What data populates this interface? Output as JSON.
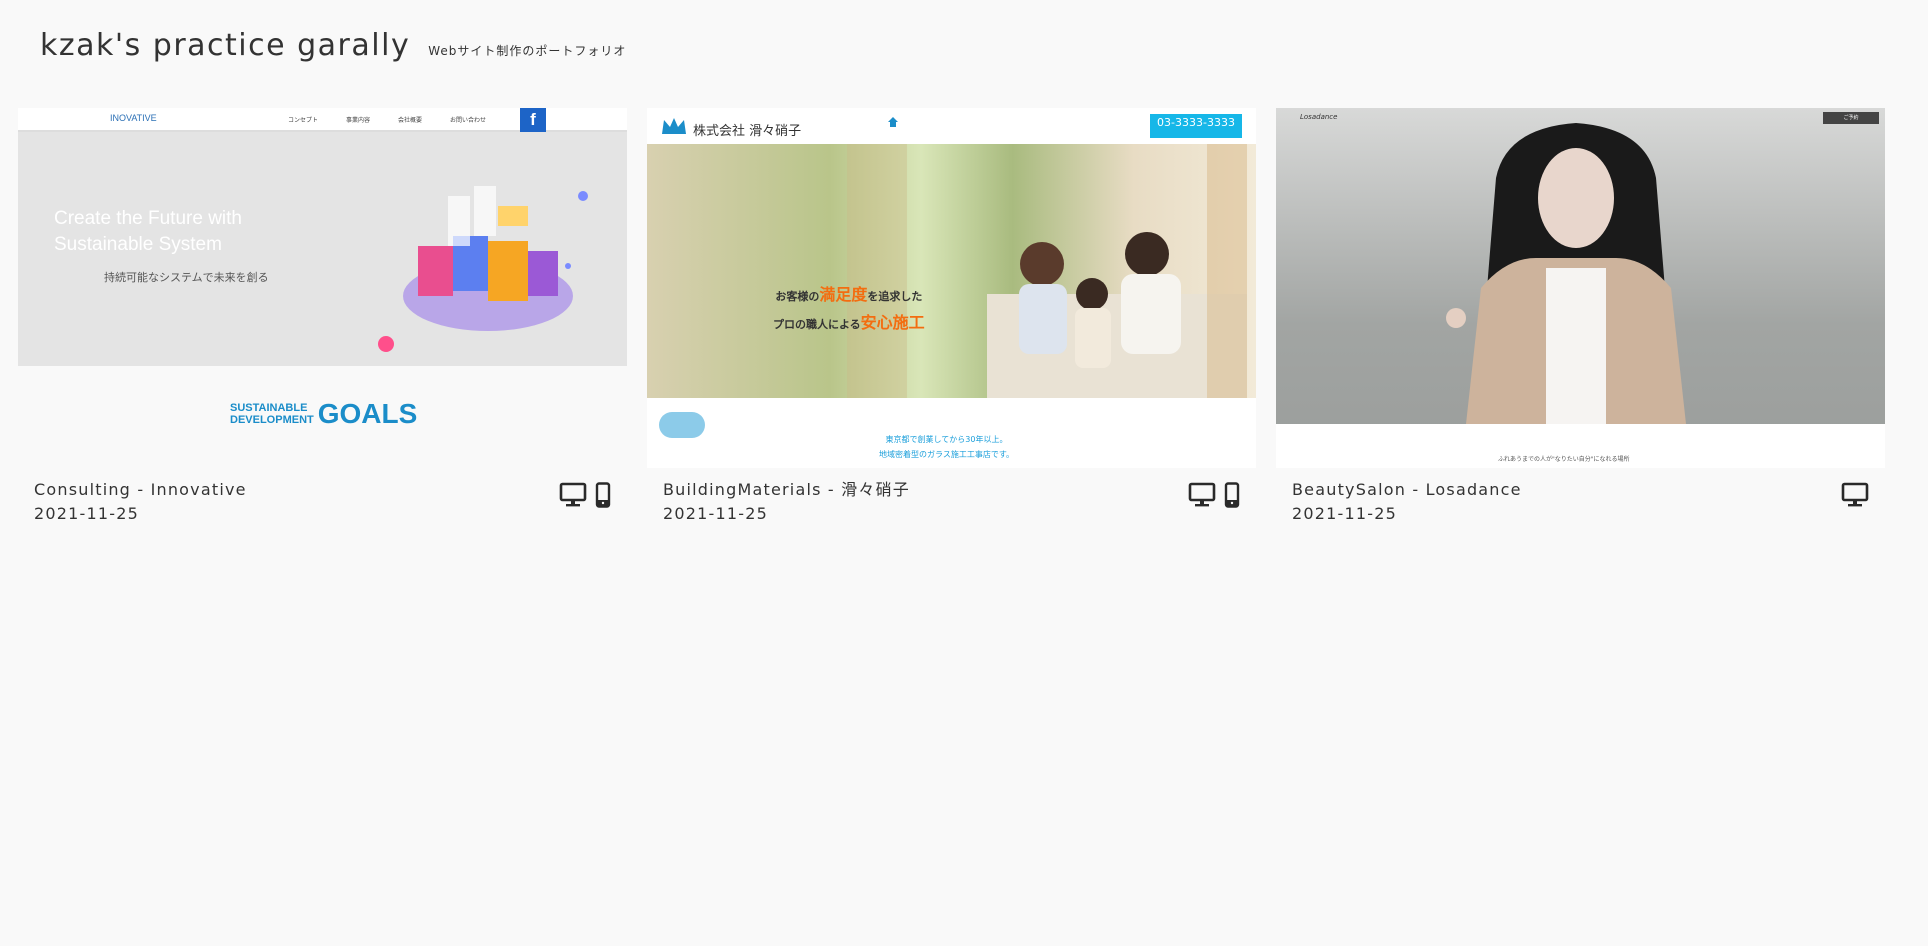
{
  "header": {
    "title": "kzak's practice garally",
    "subtitle": "Webサイト制作のポートフォリオ"
  },
  "works": [
    {
      "title": "Consulting - Innovative",
      "date": "2021-11-25",
      "devices": [
        "desktop-icon",
        "mobile-icon"
      ],
      "preview": {
        "logo": "INOVATIVE",
        "menu": [
          "コンセプト",
          "事業内容",
          "会社概要",
          "お問い合わせ"
        ],
        "hero_title_1": "Create the Future with",
        "hero_title_2": "Sustainable System",
        "hero_sub": "持続可能なシステムで未来を創る",
        "goals_small_1": "SUSTAINABLE",
        "goals_small_2": "DEVELOPMENT",
        "goals_big": "GOALS"
      }
    },
    {
      "title": "BuildingMaterials - 滑々硝子",
      "date": "2021-11-25",
      "devices": [
        "desktop-icon",
        "mobile-icon"
      ],
      "preview": {
        "company": "株式会社 滑々硝子",
        "phone": "03-3333-3333",
        "copy_1a": "お客様の",
        "copy_1b": "満足度",
        "copy_1c": "を追求した",
        "copy_2a": "プロの職人による",
        "copy_2b": "安心施工",
        "foot_1": "東京都で創業してから30年以上。",
        "foot_2": "地域密着型のガラス施工工事店です。"
      }
    },
    {
      "title": "BeautySalon - Losadance",
      "date": "2021-11-25",
      "devices": [
        "desktop-icon"
      ],
      "preview": {
        "logo": "Losadance",
        "button": "ご予約",
        "foot": "ふれあうまでの人が\"なりたい自分\"になれる場所"
      }
    }
  ],
  "colors": {
    "background": "#f9f9f9",
    "text": "#333333",
    "accent_blue": "#1b8dc9",
    "accent_orange": "#f36d10"
  }
}
